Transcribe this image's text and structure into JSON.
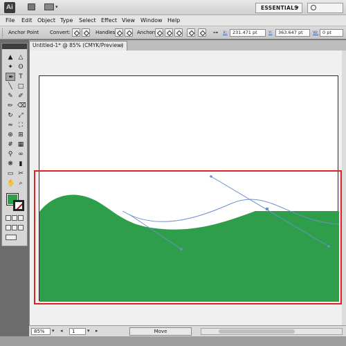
{
  "app": {
    "logo": "Ai",
    "workspace": "ESSENTIALS"
  },
  "menu": [
    "File",
    "Edit",
    "Object",
    "Type",
    "Select",
    "Effect",
    "View",
    "Window",
    "Help"
  ],
  "control": {
    "tool_label": "Anchor Point",
    "convert_label": "Convert:",
    "handles_label": "Handles:",
    "anchors_label": "Anchors:",
    "x_label": "X:",
    "x_value": "231.471 pt",
    "y_label": "Y:",
    "y_value": "363.647 pt",
    "w_label": "W:",
    "w_value": "0 pt"
  },
  "document": {
    "tab_title": "Untitled-1* @ 85% (CMYK/Preview)",
    "close_glyph": "×"
  },
  "colors": {
    "fill": "#2e9e4b",
    "annotation": "#dd2222",
    "path": "#6e8fd0"
  },
  "status": {
    "zoom": "85%",
    "artboard": "1",
    "tool": "Move"
  }
}
